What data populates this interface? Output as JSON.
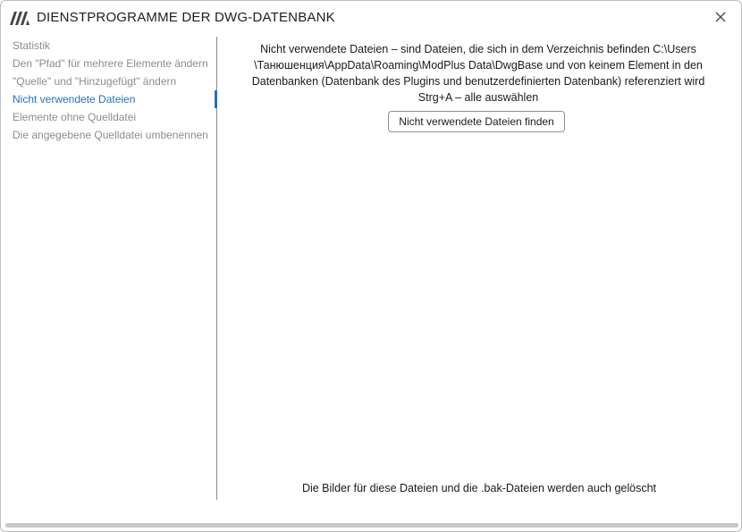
{
  "window": {
    "title": "DIENSTPROGRAMME DER DWG-DATENBANK",
    "logo_icon": "modplus-logo-icon",
    "close_icon": "close-icon"
  },
  "sidebar": {
    "items": [
      {
        "label": "Statistik",
        "active": false
      },
      {
        "label": "Den \"Pfad\" für mehrere Elemente ändern",
        "active": false
      },
      {
        "label": "\"Quelle\" und \"Hinzugefügt\" ändern",
        "active": false
      },
      {
        "label": "Nicht verwendete Dateien",
        "active": true
      },
      {
        "label": "Elemente ohne Quelldatei",
        "active": false
      },
      {
        "label": "Die angegebene Quelldatei umbenennen",
        "active": false
      }
    ]
  },
  "content": {
    "description_lines": [
      "Nicht verwendete Dateien – sind Dateien, die sich in dem Verzeichnis befinden C:\\Users",
      "\\Танюшенция\\AppData\\Roaming\\ModPlus Data\\DwgBase und von keinem Element in den",
      "Datenbanken (Datenbank des Plugins und benutzerdefinierten Datenbank) referenziert wird",
      "Strg+A – alle auswählen"
    ],
    "find_button_label": "Nicht verwendete Dateien finden",
    "footer_note": "Die Bilder für diese Dateien und die .bak-Dateien werden auch gelöscht"
  },
  "colors": {
    "accent": "#2a6fb8",
    "inactive_text": "#8c8c8c",
    "divider": "#8a8a8a"
  }
}
